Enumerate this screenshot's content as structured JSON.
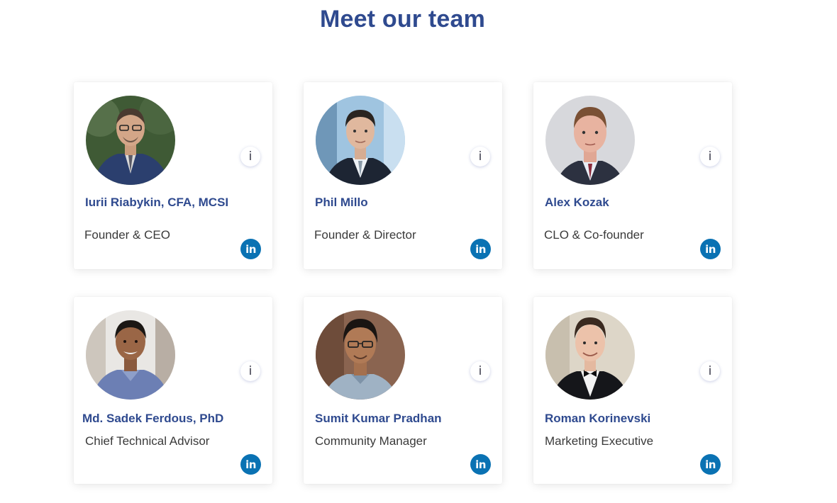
{
  "page": {
    "title": "Meet our team"
  },
  "team": [
    {
      "name": "Iurii Riabykin, CFA, MCSI",
      "role": "Founder & CEO",
      "info_label": "i",
      "linkedin_label": "in"
    },
    {
      "name": "Phil Millo",
      "role": "Founder & Director",
      "info_label": "i",
      "linkedin_label": "in"
    },
    {
      "name": "Alex Kozak",
      "role": "CLO & Co-founder",
      "info_label": "i",
      "linkedin_label": "in"
    },
    {
      "name": "Md. Sadek Ferdous, PhD",
      "role": "Chief Technical Advisor",
      "info_label": "i",
      "linkedin_label": "in"
    },
    {
      "name": "Sumit Kumar Pradhan",
      "role": "Community Manager",
      "info_label": "i",
      "linkedin_label": "in"
    },
    {
      "name": "Roman Korinevski",
      "role": "Marketing Executive",
      "info_label": "i",
      "linkedin_label": "in"
    }
  ],
  "colors": {
    "title": "#2f4a8f",
    "name": "#2f4a8f",
    "role": "#3a3a3a",
    "linkedin": "#0a72b3"
  },
  "icons": {
    "info": "info-icon",
    "linkedin": "linkedin-icon"
  }
}
